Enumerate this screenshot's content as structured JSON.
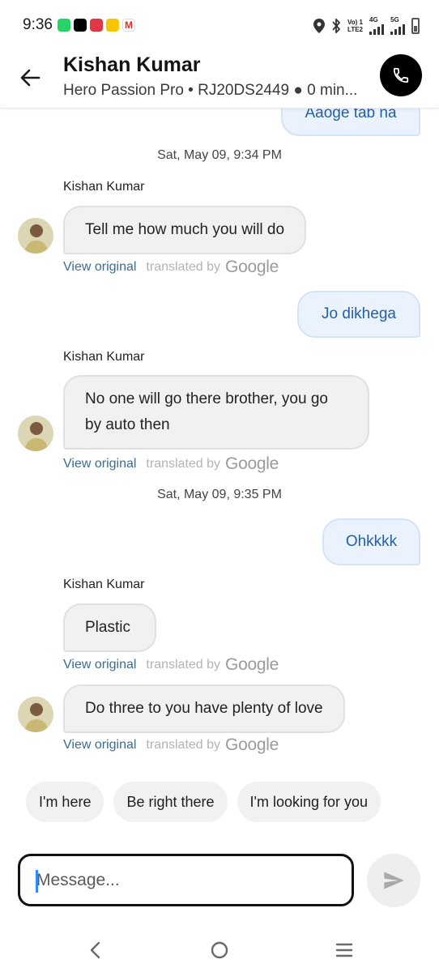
{
  "status_bar": {
    "time": "9:36",
    "network": {
      "carrier_top": "Vo) 1",
      "carrier_bottom": "LTE2",
      "net1": "4G",
      "net2": "5G"
    }
  },
  "header": {
    "contact_name": "Kishan Kumar",
    "subtitle": "Hero Passion Pro • RJ20DS2449 ● 0 min..."
  },
  "messages": [
    {
      "type": "outgoing",
      "text": "Aaoge tab na"
    },
    {
      "type": "date",
      "text": "Sat, May 09, 9:34 PM"
    },
    {
      "type": "sender",
      "text": "Kishan Kumar"
    },
    {
      "type": "incoming",
      "text": "Tell me how much you will do"
    },
    {
      "type": "outgoing",
      "text": "Jo dikhega"
    },
    {
      "type": "sender",
      "text": "Kishan Kumar"
    },
    {
      "type": "incoming",
      "text": "No one will go there brother, you go by auto then"
    },
    {
      "type": "date",
      "text": "Sat, May 09, 9:35 PM"
    },
    {
      "type": "outgoing",
      "text": "Ohkkkk"
    },
    {
      "type": "sender",
      "text": "Kishan Kumar"
    },
    {
      "type": "incoming",
      "text": "Plastic"
    },
    {
      "type": "incoming",
      "text": "Do three to you have plenty of love"
    }
  ],
  "translation": {
    "view_original": "View original",
    "translated_by": "translated by",
    "provider": "Google"
  },
  "quick_replies": [
    "I'm here",
    "Be right there",
    "I'm looking for you"
  ],
  "composer": {
    "placeholder": "Message..."
  },
  "colors": {
    "outgoing_bubble": "#eaf2fd",
    "outgoing_text": "#255fa7",
    "incoming_bubble": "#f1f1f1",
    "link": "#3c6d8f",
    "call_button": "#000000"
  }
}
